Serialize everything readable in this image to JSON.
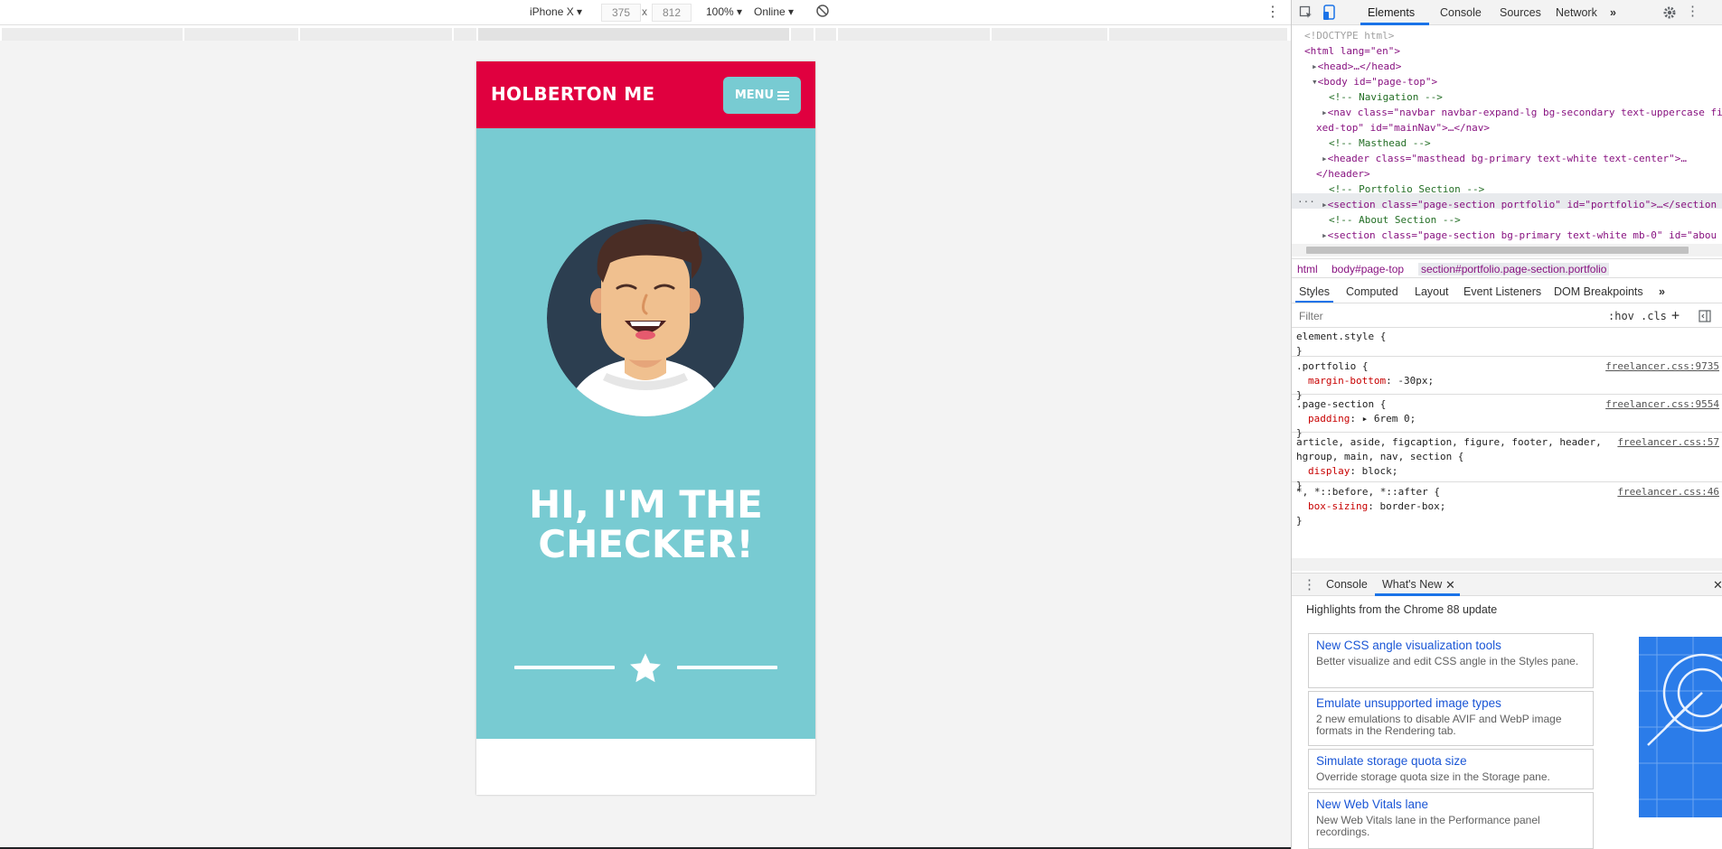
{
  "device_toolbar": {
    "device": "iPhone X",
    "width": "375",
    "times": "x",
    "height": "812",
    "zoom": "100%",
    "network": "Online"
  },
  "site": {
    "brand": "HOLBERTON ME",
    "menu_label": "MENU",
    "hero_line1": "HI, I'M THE",
    "hero_line2": "CHECKER!",
    "colors": {
      "navbar": "#e0003f",
      "masthead": "#78cbd2",
      "avatar_bg": "#2c3e50"
    }
  },
  "devtools": {
    "tabs": [
      "Elements",
      "Console",
      "Sources",
      "Network"
    ],
    "more_tabs": "»",
    "tree": {
      "doctype": "<!DOCTYPE html>",
      "html_open": "<html lang=\"en\">",
      "head": "<head>…</head>",
      "body_open": "<body id=\"page-top\">",
      "comment_nav": "<!-- Navigation -->",
      "nav_line1": "<nav class=\"navbar navbar-expand-lg bg-secondary text-uppercase fi",
      "nav_line2": "xed-top\" id=\"mainNav\">…</nav>",
      "comment_masthead": "<!-- Masthead -->",
      "header_line1": "<header class=\"masthead bg-primary text-white text-center\">…",
      "header_line2": "</header>",
      "comment_portfolio": "<!-- Portfolio Section -->",
      "section_portfolio": "<section class=\"page-section portfolio\" id=\"portfolio\">…</section",
      "comment_about": "<!-- About Section -->",
      "section_about": "<section class=\"page-section bg-primary text-white mb-0\" id=\"abou"
    },
    "breadcrumbs": [
      "html",
      "body#page-top",
      "section#portfolio.page-section.portfolio"
    ],
    "styles_tabs": [
      "Styles",
      "Computed",
      "Layout",
      "Event Listeners",
      "DOM Breakpoints"
    ],
    "filter_placeholder": "Filter",
    "filter_hov": ":hov",
    "filter_cls": ".cls",
    "filter_plus": "+",
    "rules": [
      {
        "selector": "element.style {",
        "props": [],
        "close": "}",
        "source": ""
      },
      {
        "selector": ".portfolio {",
        "props": [
          {
            "name": "margin-bottom",
            "value": "-30px;"
          }
        ],
        "close": "}",
        "source": "freelancer.css:9735"
      },
      {
        "selector": ".page-section {",
        "props": [
          {
            "name": "padding",
            "value": "▸ 6rem 0;"
          }
        ],
        "close": "}",
        "source": "freelancer.css:9554"
      },
      {
        "selector": "article, aside, figcaption, figure, footer, header,",
        "selector2": "hgroup, main, nav, section {",
        "props": [
          {
            "name": "display",
            "value": "block;"
          }
        ],
        "close": "}",
        "source": "freelancer.css:57"
      },
      {
        "selector": "*, *::before, *::after {",
        "props": [
          {
            "name": "box-sizing",
            "value": "border-box;"
          }
        ],
        "close": "}",
        "source": "freelancer.css:46"
      }
    ],
    "drawer_tabs": [
      "Console",
      "What's New"
    ],
    "whats_new": {
      "subtitle": "Highlights from the Chrome 88 update",
      "items": [
        {
          "title": "New CSS angle visualization tools",
          "desc": "Better visualize and edit CSS angle in the Styles pane."
        },
        {
          "title": "Emulate unsupported image types",
          "desc": "2 new emulations to disable AVIF and WebP image formats in the Rendering tab."
        },
        {
          "title": "Simulate storage quota size",
          "desc": "Override storage quota size in the Storage pane."
        },
        {
          "title": "New Web Vitals lane",
          "desc": "New Web Vitals lane in the Performance panel recordings."
        }
      ]
    }
  }
}
